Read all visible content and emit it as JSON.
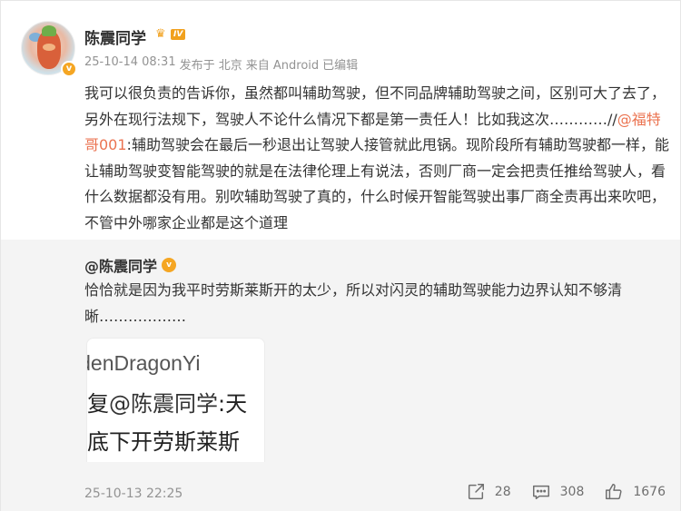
{
  "post": {
    "username": "陈震同学",
    "level_badge": "IV",
    "verified_mark": "v",
    "meta": {
      "timestamp": "25-10-14 08:31",
      "posted_from": "发布于 北京",
      "source": "来自 Android",
      "edited": "已编辑"
    },
    "content": {
      "part1": "我可以很负责的告诉你，虽然都叫辅助驾驶，但不同品牌辅助驾驶之间，区别可大了去了，另外在现行法规下，驾驶人不论什么情况下都是第一责任人！比如我这次…………//",
      "mention": "@福特哥001",
      "part2": ":辅助驾驶会在最后一秒退出让驾驶人接管就此甩锅。现阶段所有辅助驾驶都一样，能让辅助驾驶变智能驾驶的就是在法律伦理上有说法，否则厂商一定会把责任推给驾驶人，看什么数据都没有用。别吹辅助驾驶了真的，什么时候开智能驾驶出事厂商全责再出来吹吧，不管中外哪家企业都是这个道理"
    }
  },
  "repost": {
    "username": "@陈震同学",
    "verified_mark": "v",
    "text": "恰恰就是因为我平时劳斯莱斯开的太少，所以对闪灵的辅助驾驶能力边界认知不够清晰………………",
    "image": {
      "line1": "ldenDragonYi",
      "line2_prefix": "复",
      "line2_mention": "@陈震同学",
      "line2_suffix": ":天",
      "line3": "底下开劳斯莱斯"
    },
    "date": "25-10-13 22:25",
    "actions": {
      "repost_count": "28",
      "comment_count": "308",
      "like_count": "1676"
    }
  },
  "colors": {
    "mention": "#eb7350",
    "badge": "#f5a623",
    "meta_text": "#939393",
    "repost_bg": "#f4f4f4"
  },
  "icons": [
    "verified-icon",
    "crown-icon",
    "share-icon",
    "comment-icon",
    "like-icon"
  ]
}
